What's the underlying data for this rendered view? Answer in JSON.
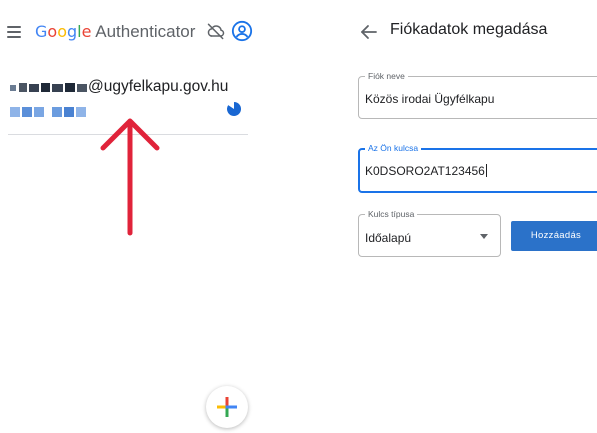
{
  "colors": {
    "accent": "#1a73e8",
    "button": "#2b72c9",
    "arrow": "#e0233a",
    "google_blue": "#4285F4",
    "google_red": "#EA4335",
    "google_yellow": "#FBBC05",
    "google_green": "#34A853"
  },
  "left": {
    "header": {
      "menu_icon": "hamburger-icon",
      "brand": "Google",
      "title": "Authenticator",
      "sync_icon": "cloud-off-icon",
      "account_icon": "account-circle-icon"
    },
    "account": {
      "email": "@ugyfelkapu.gov.hu",
      "timer_icon": "countdown-pie-icon"
    },
    "fab_icon": "add-plus-icon"
  },
  "right": {
    "back_icon": "arrow-back-icon",
    "title": "Fiókadatok megadása",
    "account_name": {
      "label": "Fiók neve",
      "value": "Közös irodai Ügyfélkapu"
    },
    "key": {
      "label": "Az Ön kulcsa",
      "value": "K0DSORO2AT123456"
    },
    "key_type": {
      "label": "Kulcs típusa",
      "value": "Időalapú"
    },
    "add_button": "Hozzáadás"
  }
}
